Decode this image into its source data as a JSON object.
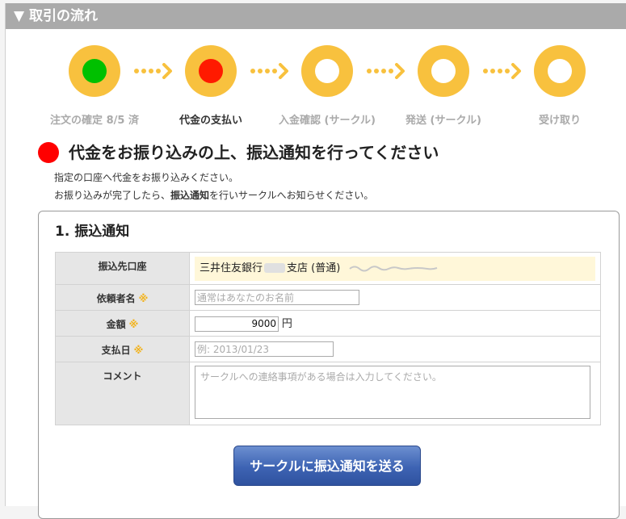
{
  "section_header": {
    "arrow": "▼",
    "title": "取引の流れ"
  },
  "steps": [
    {
      "label": "注文の確定 8/5 済",
      "status": "done",
      "dot_color": "#00c000"
    },
    {
      "label": "代金の支払い",
      "status": "current",
      "dot_color": "#ff0000"
    },
    {
      "label": "入金確認 (サークル)",
      "status": "pending"
    },
    {
      "label": "発送 (サークル)",
      "status": "pending"
    },
    {
      "label": "受け取り",
      "status": "pending"
    }
  ],
  "main": {
    "title": "代金をお振り込みの上、振込通知を行ってください",
    "desc_line1": "指定の口座へ代金をお振り込みください。",
    "desc_line2_pre": "お振り込みが完了したら、",
    "desc_line2_bold": "振込通知",
    "desc_line2_post": "を行いサークルへお知らせください。"
  },
  "panel": {
    "title": "1. 振込通知",
    "rows": {
      "account_label": "振込先口座",
      "account_value_pre": "三井住友銀行",
      "account_value_post": "支店 (普通)",
      "requester_label": "依頼者名",
      "requester_placeholder": "通常はあなたのお名前",
      "amount_label": "金額",
      "amount_value": "9000",
      "amount_unit": "円",
      "date_label": "支払日",
      "date_placeholder": "例: 2013/01/23",
      "comment_label": "コメント",
      "comment_placeholder": "サークルへの連絡事項がある場合は入力してください。",
      "required_mark": "※"
    },
    "submit_label": "サークルに振込通知を送る"
  },
  "colors": {
    "step_circle": "#f8c13e",
    "header_bg": "#aaaaaa",
    "submit_bg": "#3d63b3",
    "account_bg": "#fff7d9"
  }
}
